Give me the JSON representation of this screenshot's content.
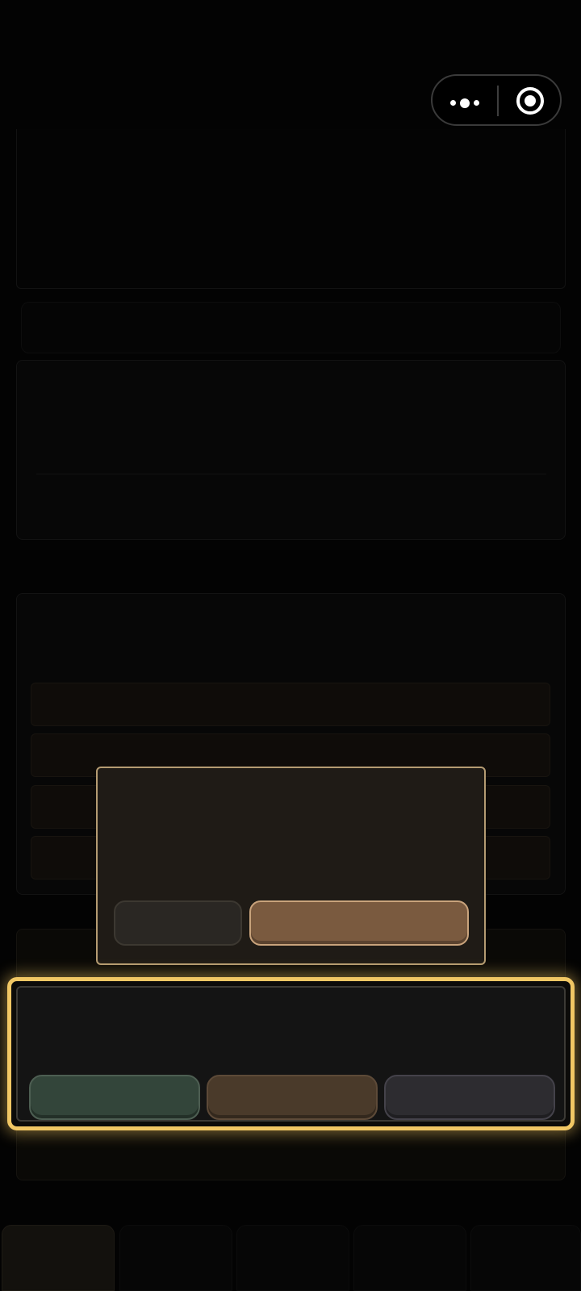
{
  "colors": {
    "background": "#030303",
    "dialog_border": "#b49b72",
    "dialog_confirm": "#7a5a3f",
    "highlight_border": "#f1c764",
    "action_green": "#33453a",
    "action_brown": "#4a3a2a",
    "action_gray": "#2d2c30"
  },
  "capsule": {
    "menu_icon": "more-dots-icon",
    "close_icon": "target-circle-icon"
  },
  "dialog": {
    "cancel_label": "",
    "confirm_label": ""
  },
  "actions": {
    "button_1_label": "",
    "button_2_label": "",
    "button_3_label": ""
  },
  "tabbar": {
    "tabs": [
      "",
      "",
      "",
      "",
      ""
    ],
    "active_index": 0
  }
}
